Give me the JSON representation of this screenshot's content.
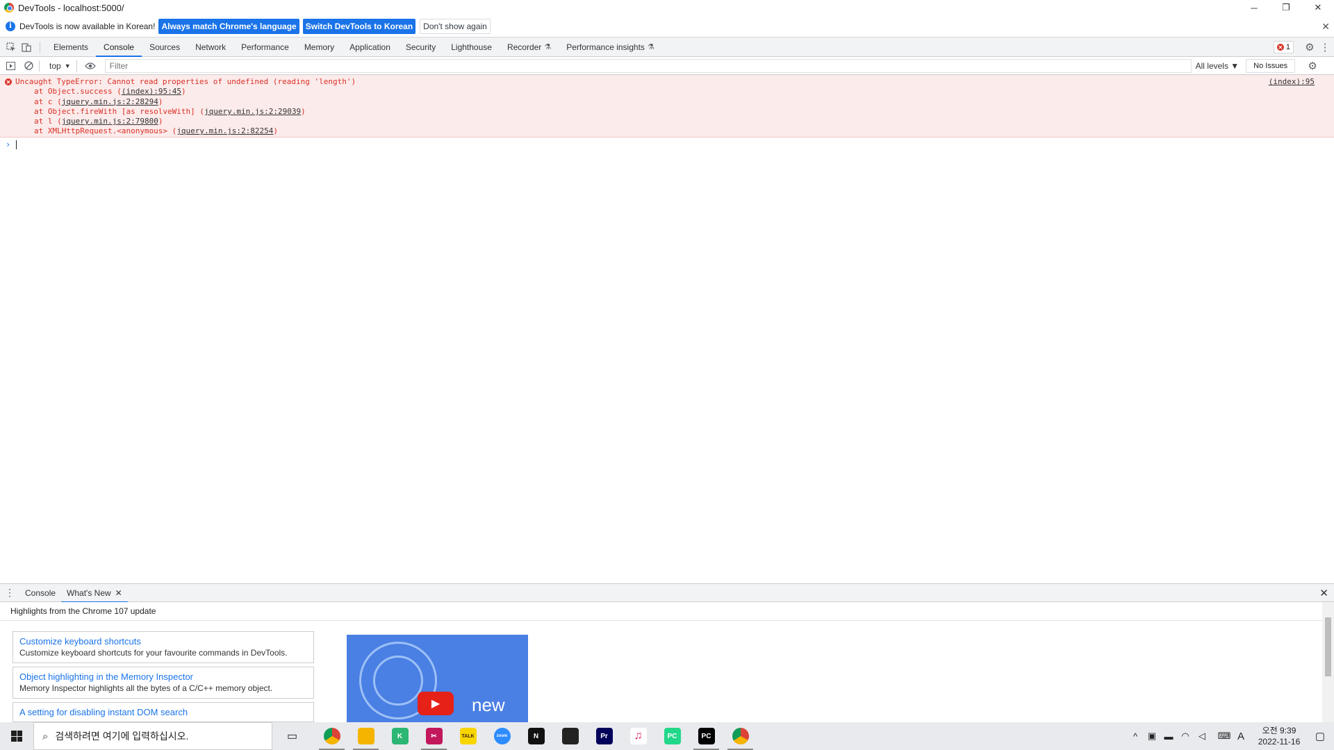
{
  "window": {
    "title": "DevTools - localhost:5000/",
    "minimize": "─",
    "restore": "❐",
    "close": "✕"
  },
  "infobar": {
    "message": "DevTools is now available in Korean!",
    "btn_match": "Always match Chrome's language",
    "btn_switch": "Switch DevTools to Korean",
    "btn_dismiss": "Don't show again",
    "close": "✕"
  },
  "tabs": [
    {
      "label": "Elements"
    },
    {
      "label": "Console",
      "active": true
    },
    {
      "label": "Sources"
    },
    {
      "label": "Network"
    },
    {
      "label": "Performance"
    },
    {
      "label": "Memory"
    },
    {
      "label": "Application"
    },
    {
      "label": "Security"
    },
    {
      "label": "Lighthouse"
    },
    {
      "label": "Recorder",
      "experimental": true
    },
    {
      "label": "Performance insights",
      "experimental": true
    }
  ],
  "error_count": "1",
  "console_toolbar": {
    "context": "top",
    "filter_placeholder": "Filter",
    "levels": "All levels ▼",
    "issues": "No Issues"
  },
  "error": {
    "message": "Uncaught TypeError: Cannot read properties of undefined (reading 'length')",
    "source": "(index):95",
    "stack": [
      {
        "prefix": "at Object.success (",
        "link": "(index):95:45",
        "suffix": ")"
      },
      {
        "prefix": "at c (",
        "link": "jquery.min.js:2:28294",
        "suffix": ")"
      },
      {
        "prefix": "at Object.fireWith [as resolveWith] (",
        "link": "jquery.min.js:2:29039",
        "suffix": ")"
      },
      {
        "prefix": "at l (",
        "link": "jquery.min.js:2:79800",
        "suffix": ")"
      },
      {
        "prefix": "at XMLHttpRequest.<anonymous> (",
        "link": "jquery.min.js:2:82254",
        "suffix": ")"
      }
    ]
  },
  "drawer": {
    "tabs": [
      "Console",
      "What's New"
    ],
    "highlights": "Highlights from the Chrome 107 update",
    "cards": [
      {
        "title": "Customize keyboard shortcuts",
        "desc": "Customize keyboard shortcuts for your favourite commands in DevTools."
      },
      {
        "title": "Object highlighting in the Memory Inspector",
        "desc": "Memory Inspector highlights all the bytes of a C/C++ memory object."
      },
      {
        "title": "A setting for disabling instant DOM search",
        "desc": ""
      }
    ],
    "video_text": "new"
  },
  "taskbar": {
    "search_placeholder": "검색하려면 여기에 입력하십시오.",
    "apps": [
      {
        "name": "chrome",
        "color": "#db4437",
        "label": "",
        "active": true
      },
      {
        "name": "file-explorer",
        "color": "#f4b400",
        "label": "",
        "active": true
      },
      {
        "name": "app-green",
        "color": "#2bb673",
        "label": "K",
        "active": false
      },
      {
        "name": "snip-tool",
        "color": "#c2185b",
        "label": "✂",
        "active": true
      },
      {
        "name": "kakaotalk",
        "color": "#f7d600",
        "label": "TALK",
        "active": false
      },
      {
        "name": "zoom",
        "color": "#2d8cff",
        "label": "zoom",
        "active": false
      },
      {
        "name": "notion",
        "color": "#111111",
        "label": "N",
        "active": false
      },
      {
        "name": "sticky-notes",
        "color": "#222222",
        "label": "",
        "active": false
      },
      {
        "name": "premiere",
        "color": "#00005b",
        "label": "Pr",
        "active": false
      },
      {
        "name": "itunes",
        "color": "#ffffff",
        "label": "♫",
        "active": false
      },
      {
        "name": "pycharm-1",
        "color": "#21d789",
        "label": "PC",
        "active": false
      },
      {
        "name": "pycharm-2",
        "color": "#000000",
        "label": "PC",
        "active": true
      },
      {
        "name": "chrome-2",
        "color": "#db4437",
        "label": "",
        "active": true
      }
    ],
    "ime": "A",
    "time": "오전 9:39",
    "date": "2022-11-16"
  }
}
